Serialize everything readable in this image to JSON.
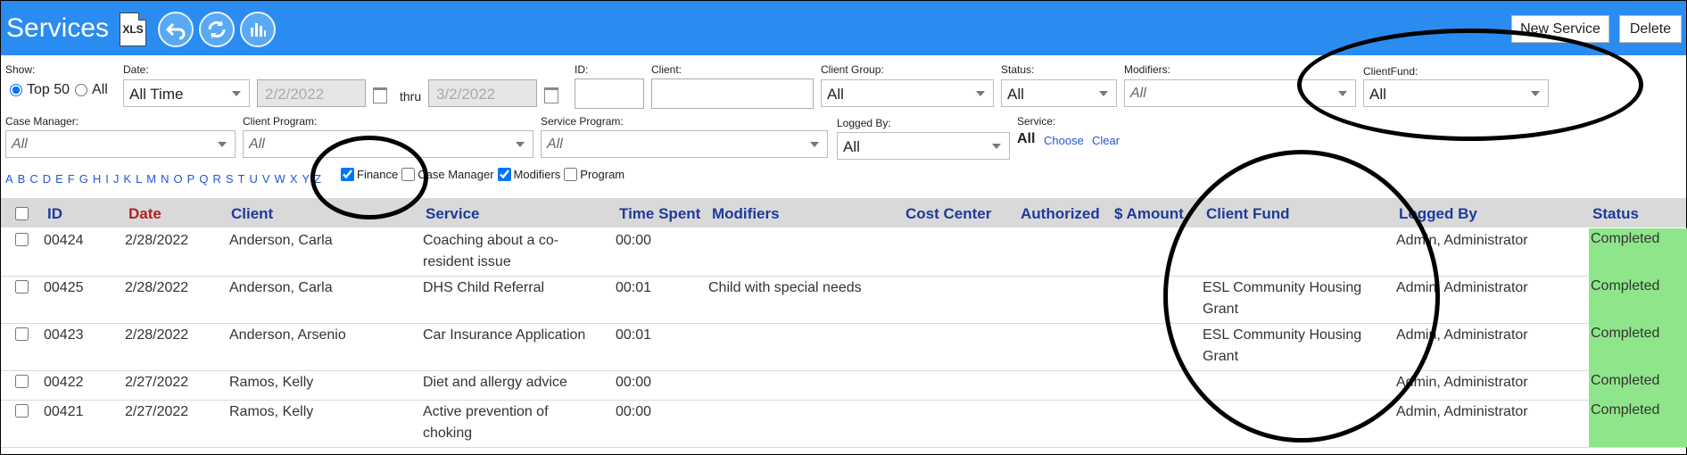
{
  "header": {
    "title": "Services",
    "xls_label": "XLS",
    "new_service_label": "New Service",
    "delete_label": "Delete",
    "icons": [
      "xls-file-icon",
      "back-arrow-icon",
      "refresh-icon",
      "bar-chart-icon"
    ]
  },
  "filters": {
    "show_label": "Show:",
    "top50_label": "Top 50",
    "all_label": "All",
    "date_label": "Date:",
    "date_value": "All Time",
    "date_from": "2/2/2022",
    "thru_label": "thru",
    "date_to": "3/2/2022",
    "id_label": "ID:",
    "client_label": "Client:",
    "client_group_label": "Client Group:",
    "client_group_value": "All",
    "status_label": "Status:",
    "status_value": "All",
    "modifiers_label": "Modifiers:",
    "modifiers_value": "All",
    "client_fund_label": "ClientFund:",
    "client_fund_value": "All",
    "case_manager_label": "Case Manager:",
    "case_manager_value": "All",
    "client_program_label": "Client Program:",
    "client_program_value": "All",
    "service_program_label": "Service Program:",
    "service_program_value": "All",
    "logged_by_label": "Logged By:",
    "logged_by_value": "All",
    "service_label": "Service:",
    "service_value": "All",
    "choose_label": "Choose",
    "clear_label": "Clear",
    "alphabet": [
      "A",
      "B",
      "C",
      "D",
      "E",
      "F",
      "G",
      "H",
      "I",
      "J",
      "K",
      "L",
      "M",
      "N",
      "O",
      "P",
      "Q",
      "R",
      "S",
      "T",
      "U",
      "V",
      "W",
      "X",
      "Y",
      "Z"
    ],
    "check_finance": "Finance",
    "check_case_manager": "Case Manager",
    "check_modifiers": "Modifiers",
    "check_program": "Program"
  },
  "table": {
    "columns": [
      "ID",
      "Date",
      "Client",
      "Service",
      "Time Spent",
      "Modifiers",
      "Cost Center",
      "Authorized",
      "$ Amount",
      "Client Fund",
      "Logged By",
      "Status"
    ],
    "rows": [
      {
        "id": "00424",
        "date": "2/28/2022",
        "client": "Anderson, Carla",
        "service1": "Coaching about a co-",
        "service2": "resident issue",
        "time": "00:00",
        "modifiers": "",
        "fund1": "",
        "fund2": "",
        "logged": "Admin, Administrator",
        "status": "Completed"
      },
      {
        "id": "00425",
        "date": "2/28/2022",
        "client": "Anderson, Carla",
        "service1": "DHS Child Referral",
        "service2": "",
        "time": "00:01",
        "modifiers": "Child with special needs",
        "fund1": "ESL Community Housing",
        "fund2": "Grant",
        "logged": "Admin, Administrator",
        "status": "Completed"
      },
      {
        "id": "00423",
        "date": "2/28/2022",
        "client": "Anderson, Arsenio",
        "service1": "Car Insurance Application",
        "service2": "",
        "time": "00:01",
        "modifiers": "",
        "fund1": "ESL Community Housing",
        "fund2": "Grant",
        "logged": "Admin, Administrator",
        "status": "Completed"
      },
      {
        "id": "00422",
        "date": "2/27/2022",
        "client": "Ramos, Kelly",
        "service1": "Diet and allergy advice",
        "service2": "",
        "time": "00:00",
        "modifiers": "",
        "fund1": "",
        "fund2": "",
        "logged": "Admin, Administrator",
        "status": "Completed"
      },
      {
        "id": "00421",
        "date": "2/27/2022",
        "client": "Ramos, Kelly",
        "service1": "Active prevention of",
        "service2": "choking",
        "time": "00:00",
        "modifiers": "",
        "fund1": "",
        "fund2": "",
        "logged": "Admin, Administrator",
        "status": "Completed"
      }
    ]
  },
  "colors": {
    "header_bg": "#2a8cf0",
    "status_completed": "#8fe68a",
    "link": "#2256d8",
    "header_text": "#1e3a9a",
    "date_header": "#b22222"
  }
}
